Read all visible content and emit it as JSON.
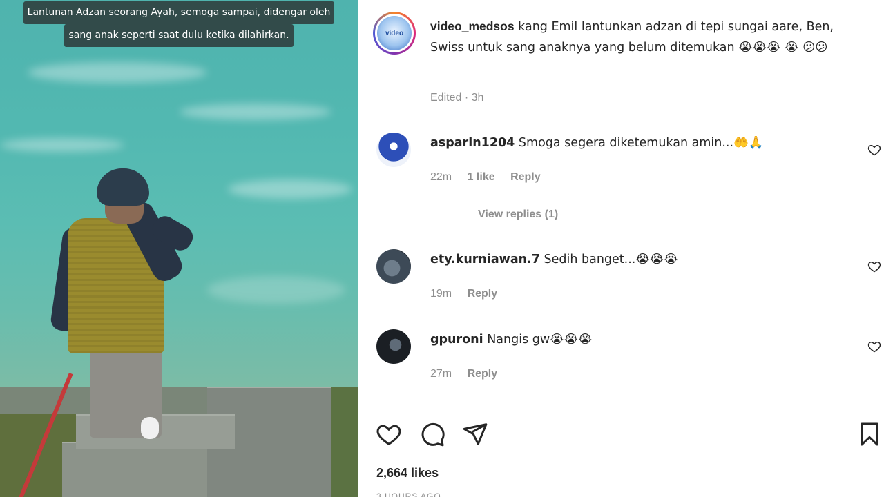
{
  "media": {
    "caption_line1": "Lantunan Adzan seorang Ayah, semoga sampai, didengar oleh",
    "caption_line2": "sang anak seperti saat dulu ketika dilahirkan."
  },
  "post": {
    "account_logo_text": "video",
    "username": "video_medsos",
    "caption": " kang Emil lantunkan adzan di tepi sungai aare, Ben, Swiss untuk sang anaknya yang belum ditemukan 😭😭😭 😭 😕😕",
    "edited_label": "Edited · 3h"
  },
  "comments": [
    {
      "username": "asparin1204",
      "text": " Smoga segera diketemukan amin...🤲🙏",
      "time": "22m",
      "likes": "1 like",
      "reply": "Reply",
      "avatar_color": "#2d4fb8"
    },
    {
      "username": "ety.kurniawan.7",
      "text": " Sedih banget...😭😭😭",
      "time": "19m",
      "reply": "Reply",
      "avatar_color": "#3d4a57"
    },
    {
      "username": "gpuroni",
      "text": " Nangis gw😭😭😭",
      "time": "27m",
      "reply": "Reply",
      "avatar_color": "#1b1f24"
    }
  ],
  "view_replies": "View replies (1)",
  "likes": "2,664 likes",
  "time_ago": "3 HOURS AGO",
  "icons": {
    "like": "heart-icon",
    "comment": "comment-icon",
    "share": "send-icon",
    "save": "bookmark-icon"
  }
}
